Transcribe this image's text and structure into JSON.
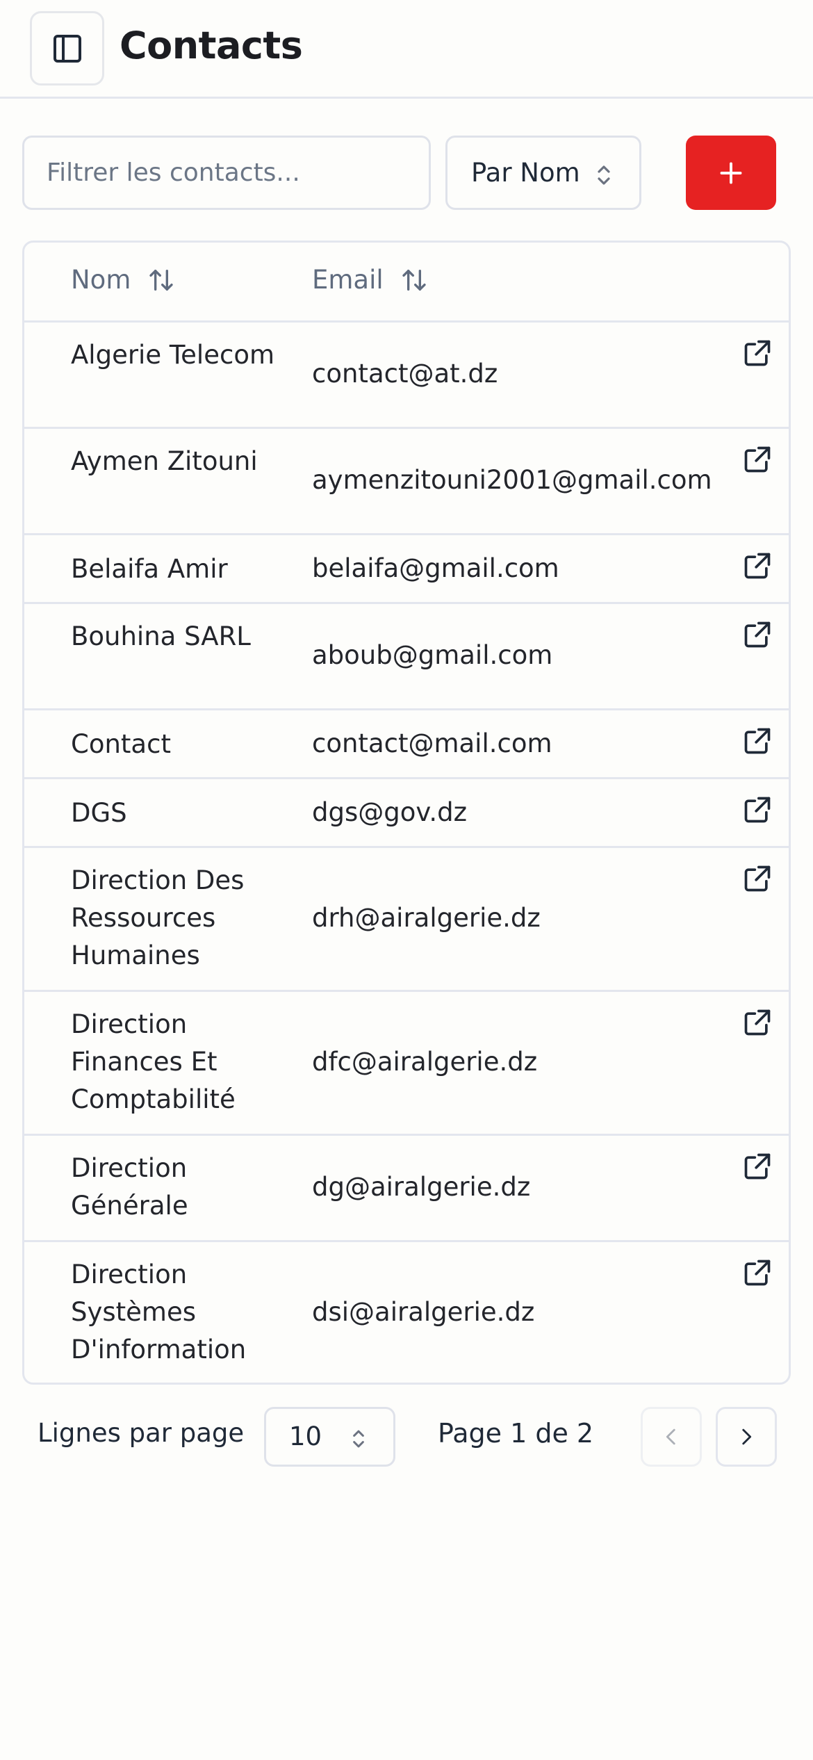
{
  "header": {
    "title": "Contacts",
    "sidebar_icon": "panel-left-icon"
  },
  "toolbar": {
    "filter_placeholder": "Filtrer les contacts...",
    "filter_value": "",
    "sort_label": "Par Nom",
    "add_label": "+",
    "add_color": "#e62222"
  },
  "table": {
    "columns": [
      {
        "label": "Nom",
        "icon": "sort-arrows-icon"
      },
      {
        "label": "Email",
        "icon": "sort-arrows-icon"
      }
    ],
    "rows": [
      {
        "name": "Algerie Telecom",
        "email": "contact@at.dz"
      },
      {
        "name": "Aymen Zitouni",
        "email": "aymenzitouni2001@gmail.com"
      },
      {
        "name": "Belaifa Amir",
        "email": "belaifa@gmail.com"
      },
      {
        "name": "Bouhina SARL",
        "email": "aboub@gmail.com"
      },
      {
        "name": "Contact",
        "email": "contact@mail.com"
      },
      {
        "name": "DGS",
        "email": "dgs@gov.dz"
      },
      {
        "name": "Direction Des Ressources Humaines",
        "email": "drh@airalgerie.dz"
      },
      {
        "name": "Direction Finances Et Comptabilité",
        "email": "dfc@airalgerie.dz"
      },
      {
        "name": "Direction Générale",
        "email": "dg@airalgerie.dz"
      },
      {
        "name": "Direction Systèmes D'information",
        "email": "dsi@airalgerie.dz"
      }
    ],
    "row_action_icon": "external-link-icon"
  },
  "pagination": {
    "rows_per_page_label": "Lignes par page",
    "rows_per_page_value": "10",
    "page_info": "Page 1 de 2",
    "prev_icon": "chevron-left-icon",
    "next_icon": "chevron-right-icon"
  }
}
